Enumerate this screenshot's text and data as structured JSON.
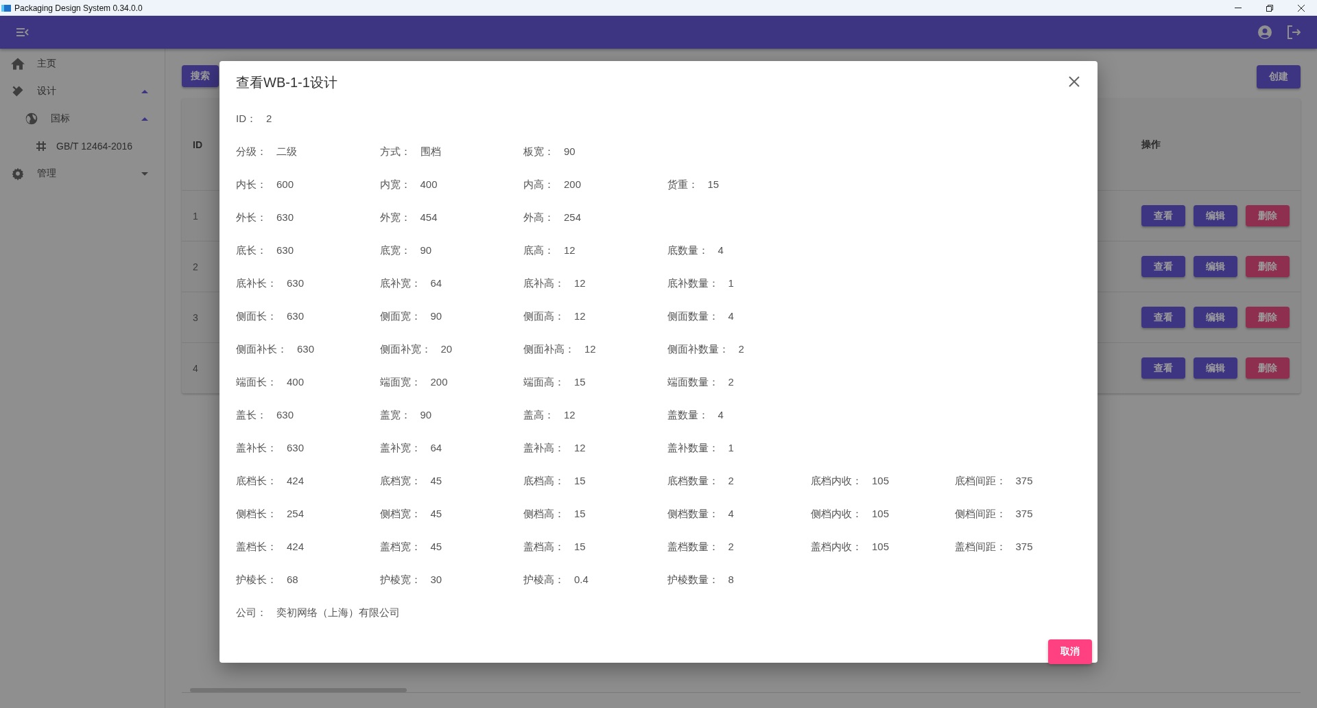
{
  "window": {
    "title": "Packaging Design System 0.34.0.0"
  },
  "sidebar": {
    "items": [
      {
        "label": "主页"
      },
      {
        "label": "设计",
        "expanded": true,
        "children": [
          {
            "label": "国标",
            "expanded": true,
            "children": [
              {
                "label": "GB/T 12464-2016"
              }
            ]
          }
        ]
      },
      {
        "label": "管理",
        "expanded": false
      }
    ]
  },
  "toolbar": {
    "search_button": "搜索",
    "create_button": "创建"
  },
  "table": {
    "columns": [
      "ID",
      "操作"
    ],
    "rows": [
      {
        "id": "1",
        "actions": [
          {
            "label": "查看",
            "kind": "primary"
          },
          {
            "label": "编辑",
            "kind": "primary"
          },
          {
            "label": "删除",
            "kind": "danger"
          }
        ]
      },
      {
        "id": "2",
        "actions": [
          {
            "label": "查看",
            "kind": "primary"
          },
          {
            "label": "编辑",
            "kind": "primary"
          },
          {
            "label": "删除",
            "kind": "danger"
          }
        ]
      },
      {
        "id": "3",
        "actions": [
          {
            "label": "查看",
            "kind": "primary"
          },
          {
            "label": "编辑",
            "kind": "primary"
          },
          {
            "label": "删除",
            "kind": "danger"
          }
        ]
      },
      {
        "id": "4",
        "actions": [
          {
            "label": "查看",
            "kind": "primary"
          },
          {
            "label": "编辑",
            "kind": "primary"
          },
          {
            "label": "删除",
            "kind": "danger"
          }
        ]
      }
    ]
  },
  "dialog": {
    "title": "查看WB-1-1设计",
    "rows": [
      [
        {
          "label": "ID：",
          "value": "2"
        }
      ],
      [
        {
          "label": "分级：",
          "value": "二级"
        },
        {
          "label": "方式：",
          "value": "围档"
        },
        {
          "label": "板宽：",
          "value": "90"
        }
      ],
      [
        {
          "label": "内长：",
          "value": "600"
        },
        {
          "label": "内宽：",
          "value": "400"
        },
        {
          "label": "内高：",
          "value": "200"
        },
        {
          "label": "货重：",
          "value": "15"
        }
      ],
      [
        {
          "label": "外长：",
          "value": "630"
        },
        {
          "label": "外宽：",
          "value": "454"
        },
        {
          "label": "外高：",
          "value": "254"
        }
      ],
      [
        {
          "label": "底长：",
          "value": "630"
        },
        {
          "label": "底宽：",
          "value": "90"
        },
        {
          "label": "底高：",
          "value": "12"
        },
        {
          "label": "底数量：",
          "value": "4"
        }
      ],
      [
        {
          "label": "底补长：",
          "value": "630"
        },
        {
          "label": "底补宽：",
          "value": "64"
        },
        {
          "label": "底补高：",
          "value": "12"
        },
        {
          "label": "底补数量：",
          "value": "1"
        }
      ],
      [
        {
          "label": "侧面长：",
          "value": "630"
        },
        {
          "label": "侧面宽：",
          "value": "90"
        },
        {
          "label": "侧面高：",
          "value": "12"
        },
        {
          "label": "侧面数量：",
          "value": "4"
        }
      ],
      [
        {
          "label": "侧面补长：",
          "value": "630"
        },
        {
          "label": "侧面补宽：",
          "value": "20"
        },
        {
          "label": "侧面补高：",
          "value": "12"
        },
        {
          "label": "侧面补数量：",
          "value": "2"
        }
      ],
      [
        {
          "label": "端面长：",
          "value": "400"
        },
        {
          "label": "端面宽：",
          "value": "200"
        },
        {
          "label": "端面高：",
          "value": "15"
        },
        {
          "label": "端面数量：",
          "value": "2"
        }
      ],
      [
        {
          "label": "盖长：",
          "value": "630"
        },
        {
          "label": "盖宽：",
          "value": "90"
        },
        {
          "label": "盖高：",
          "value": "12"
        },
        {
          "label": "盖数量：",
          "value": "4"
        }
      ],
      [
        {
          "label": "盖补长：",
          "value": "630"
        },
        {
          "label": "盖补宽：",
          "value": "64"
        },
        {
          "label": "盖补高：",
          "value": "12"
        },
        {
          "label": "盖补数量：",
          "value": "1"
        }
      ],
      [
        {
          "label": "底档长：",
          "value": "424"
        },
        {
          "label": "底档宽：",
          "value": "45"
        },
        {
          "label": "底档高：",
          "value": "15"
        },
        {
          "label": "底档数量：",
          "value": "2"
        },
        {
          "label": "底档内收：",
          "value": "105"
        },
        {
          "label": "底档间距：",
          "value": "375"
        }
      ],
      [
        {
          "label": "侧档长：",
          "value": "254"
        },
        {
          "label": "侧档宽：",
          "value": "45"
        },
        {
          "label": "侧档高：",
          "value": "15"
        },
        {
          "label": "侧档数量：",
          "value": "4"
        },
        {
          "label": "侧档内收：",
          "value": "105"
        },
        {
          "label": "侧档间距：",
          "value": "375"
        }
      ],
      [
        {
          "label": "盖档长：",
          "value": "424"
        },
        {
          "label": "盖档宽：",
          "value": "45"
        },
        {
          "label": "盖档高：",
          "value": "15"
        },
        {
          "label": "盖档数量：",
          "value": "2"
        },
        {
          "label": "盖档内收：",
          "value": "105"
        },
        {
          "label": "盖档间距：",
          "value": "375"
        }
      ],
      [
        {
          "label": "护棱长：",
          "value": "68"
        },
        {
          "label": "护棱宽：",
          "value": "30"
        },
        {
          "label": "护棱高：",
          "value": "0.4"
        },
        {
          "label": "护棱数量：",
          "value": "8"
        }
      ],
      [
        {
          "label": "公司：",
          "value": "奕初网络（上海）有限公司"
        }
      ]
    ],
    "cancel_button": "取消"
  }
}
